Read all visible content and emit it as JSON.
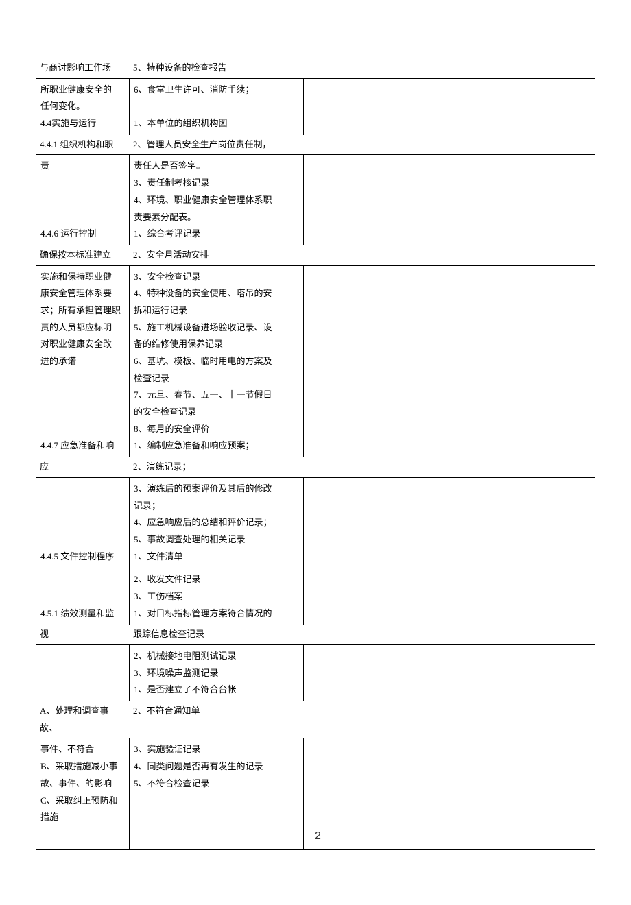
{
  "header_row": {
    "left": "与商讨影响工作场",
    "mid": "5、特种设备的检查报告"
  },
  "sections": [
    {
      "type": "boxed",
      "left": [
        "所职业健康安全的",
        "任何变化。",
        "4.4实施与运行"
      ],
      "mid": [
        "6、食堂卫生许可、消防手续；",
        "",
        "1、本单位的组织机构图"
      ]
    },
    {
      "type": "plain",
      "left": "4.4.1  组织机构和职",
      "mid": "2、管理人员安全生产岗位责任制，"
    },
    {
      "type": "boxed",
      "left": [
        "责",
        "",
        "",
        "",
        "4.4.6  运行控制"
      ],
      "mid": [
        "责任人是否签字。",
        "3、责任制考核记录",
        "4、环境、职业健康安全管理体系职",
        "责要素分配表。",
        "1、综合考评记录"
      ]
    },
    {
      "type": "plain",
      "left": "确保按本标准建立",
      "mid": "2、安全月活动安排"
    },
    {
      "type": "boxed",
      "left": [
        "实施和保持职业健",
        "康安全管理体系要",
        "求；所有承担管理职",
        "责的人员都应标明",
        "对职业健康安全改",
        "进的承诺",
        "",
        "",
        "",
        "",
        "4.4.7  应急准备和响"
      ],
      "mid": [
        "3、安全检查记录",
        "4、特种设备的安全使用、塔吊的安",
        "拆和运行记录",
        "5、施工机械设备进场验收记录、设",
        "备的维修使用保养记录",
        "6、基坑、模板、临时用电的方案及",
        "检查记录",
        "7、元旦、春节、五一、十一节假日",
        "的安全检查记录",
        "8、每月的安全评价",
        "1、编制应急准备和响应预案；"
      ]
    },
    {
      "type": "plain",
      "left": "应",
      "mid": "2、演练记录；"
    },
    {
      "type": "boxed",
      "left": [
        "",
        "",
        "",
        "",
        "4.4.5  文件控制程序"
      ],
      "mid": [
        "3、演练后的预案评价及其后的修改",
        "记录；",
        "4、应急响应后的总结和评价记录；",
        "5、事故调查处理的相关记录",
        "1、文件清单"
      ]
    },
    {
      "type": "boxed",
      "left": [
        "",
        "",
        "4.5.1  绩效测量和监"
      ],
      "mid": [
        "2、收发文件记录",
        "3、工伤档案",
        "1、对目标指标管理方案符合情况的"
      ]
    },
    {
      "type": "plain",
      "left": "视",
      "mid": "跟踪信息检查记录"
    },
    {
      "type": "boxed",
      "left": [
        "",
        "",
        ""
      ],
      "mid": [
        "2、机械接地电阻测试记录",
        "3、环境噪声监测记录",
        "1、是否建立了不符合台帐"
      ]
    },
    {
      "type": "plain",
      "left": "A、处理和调查事故、",
      "mid": "2、不符合通知单"
    },
    {
      "type": "boxed",
      "last": true,
      "left": [
        "事件、不符合",
        "B、采取措施减小事",
        "故、事件、的影响",
        "C、采取纠正预防和",
        "措施",
        ""
      ],
      "mid": [
        "3、实施验证记录",
        "4、同类问题是否再有发生的记录",
        "5、不符合检查记录",
        "",
        "",
        ""
      ],
      "right_last": "2"
    }
  ]
}
